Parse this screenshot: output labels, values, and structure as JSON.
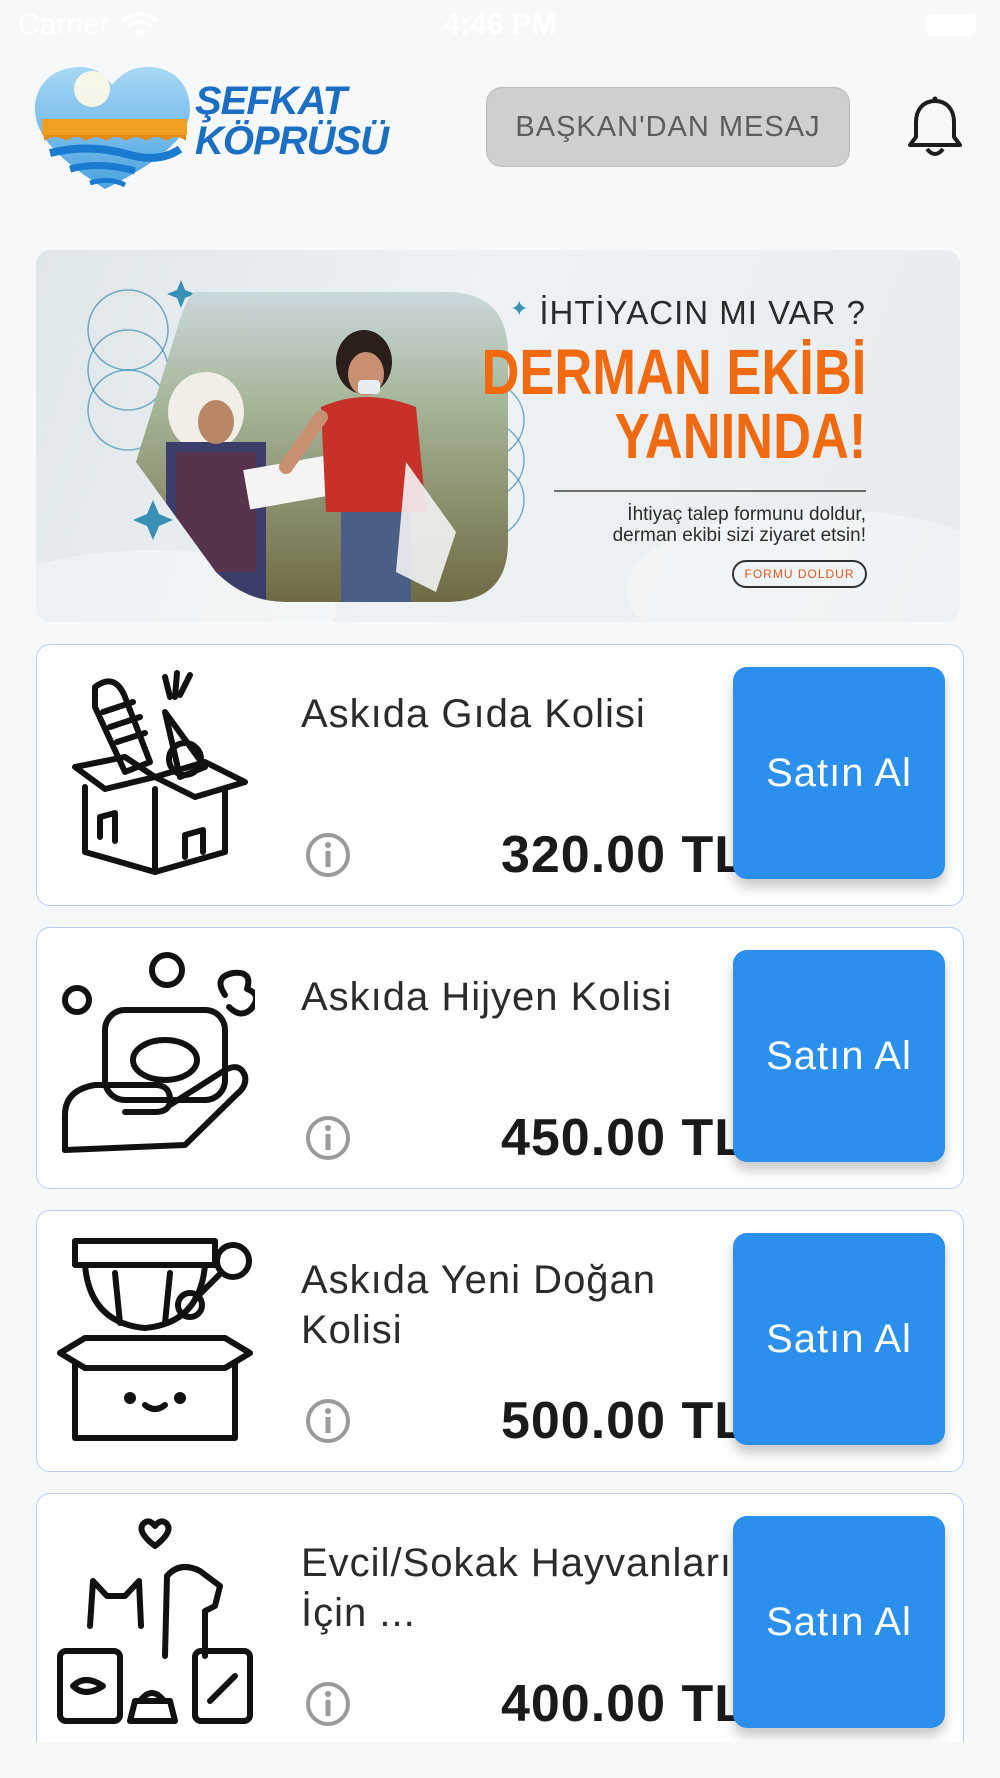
{
  "status_bar": {
    "carrier": "Carrier",
    "time": "4:46 PM"
  },
  "header": {
    "logo_text_line1": "ŞEFKAT",
    "logo_text_line2": "KÖPRÜSÜ",
    "message_button_label": "BAŞKAN'DAN MESAJ",
    "notification_icon": "bell-icon"
  },
  "banner": {
    "question": "İHTİYACIN MI VAR ?",
    "headline_line1": "DERMAN EKİBİ",
    "headline_line2": "YANINDA!",
    "description_line1": "İhtiyaç talep formunu doldur,",
    "description_line2": "derman ekibi sizi ziyaret etsin!",
    "button_label": "FORMU DOLDUR",
    "accent_color": "#f26a10"
  },
  "products": [
    {
      "name": "Askıda Gıda Kolisi",
      "price": "320.00 TL",
      "buy_label": "Satın Al",
      "icon": "food-box-icon"
    },
    {
      "name": "Askıda Hijyen Kolisi",
      "price": "450.00 TL",
      "buy_label": "Satın Al",
      "icon": "hygiene-hand-icon"
    },
    {
      "name": "Askıda Yeni Doğan Kolisi",
      "price": "500.00 TL",
      "buy_label": "Satın Al",
      "icon": "newborn-box-icon"
    },
    {
      "name": "Evcil/Sokak Hayvanları İçin ...",
      "price": "400.00 TL",
      "buy_label": "Satın Al",
      "icon": "pet-food-icon"
    }
  ],
  "colors": {
    "buy_button": "#2b8fee",
    "card_border": "#b9cdf2",
    "message_button_bg": "#cfcfcf"
  }
}
